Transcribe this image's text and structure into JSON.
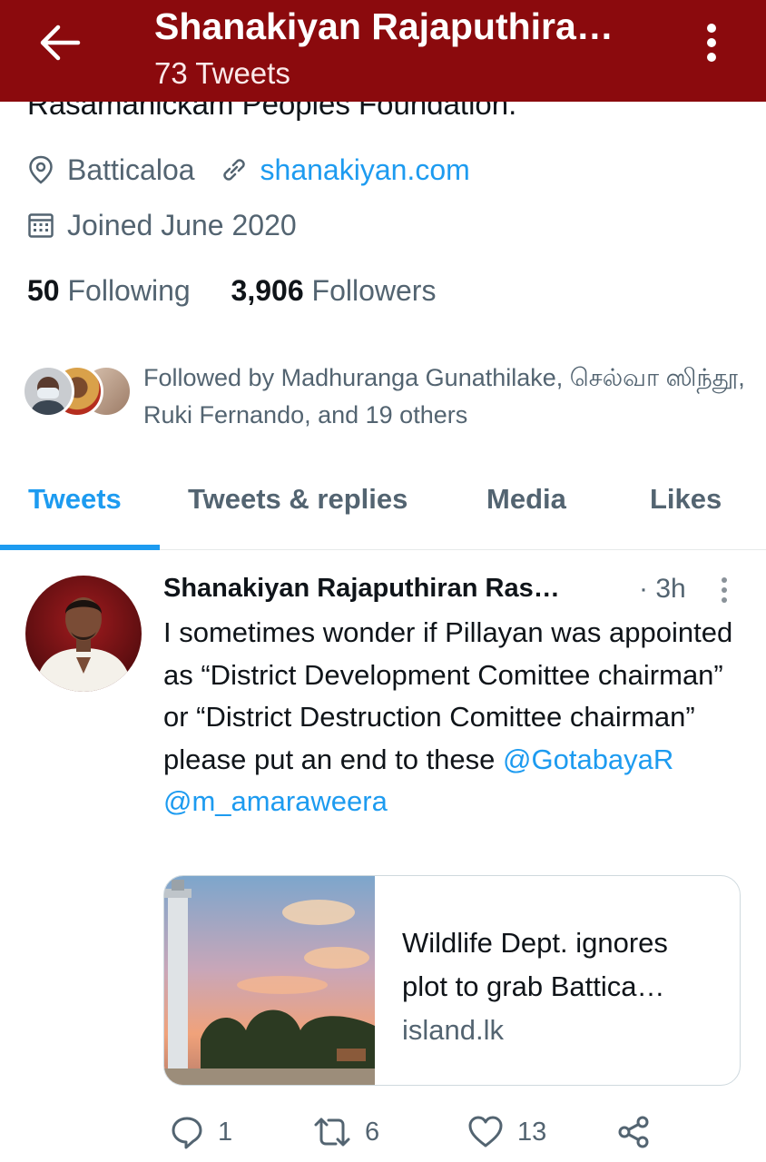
{
  "header": {
    "title": "Shanakiyan Rajaputhira…",
    "subtitle": "73 Tweets",
    "back_icon": "arrow-left-icon",
    "more_icon": "more-vertical-icon",
    "bg_color": "#8b0a0d"
  },
  "profile": {
    "bio_partial": "Rasamanickam Peoples Foundation.",
    "location": "Batticaloa",
    "website": "shanakiyan.com",
    "joined": "Joined June 2020",
    "following_count": "50",
    "following_label": "Following",
    "followers_count": "3,906",
    "followers_label": "Followers",
    "followed_by": "Followed by Madhuranga Gunathilake, செல்வா ஸிந்தூ, Ruki Fernando, and 19 others"
  },
  "tabs": [
    {
      "label": "Tweets",
      "active": true
    },
    {
      "label": "Tweets & replies",
      "active": false
    },
    {
      "label": "Media",
      "active": false
    },
    {
      "label": "Likes",
      "active": false
    }
  ],
  "tweet": {
    "author": "Shanakiyan Rajaputhiran Ras…",
    "time": "· 3h",
    "text": "I sometimes wonder if Pillayan was appointed as “District Development Comittee chairman” or “District Destruction Comittee chairman” please put an end to these ",
    "mention1": "@GotabayaR",
    "mention2": "@m_amaraweera",
    "card": {
      "title_line1": "Wildlife Dept. ignores",
      "title_line2": "plot to grab Battica…",
      "domain": "island.lk"
    },
    "replies": "1",
    "retweets": "6",
    "likes": "13"
  },
  "colors": {
    "accent": "#1d9bf0",
    "secondary_text": "#536471"
  }
}
